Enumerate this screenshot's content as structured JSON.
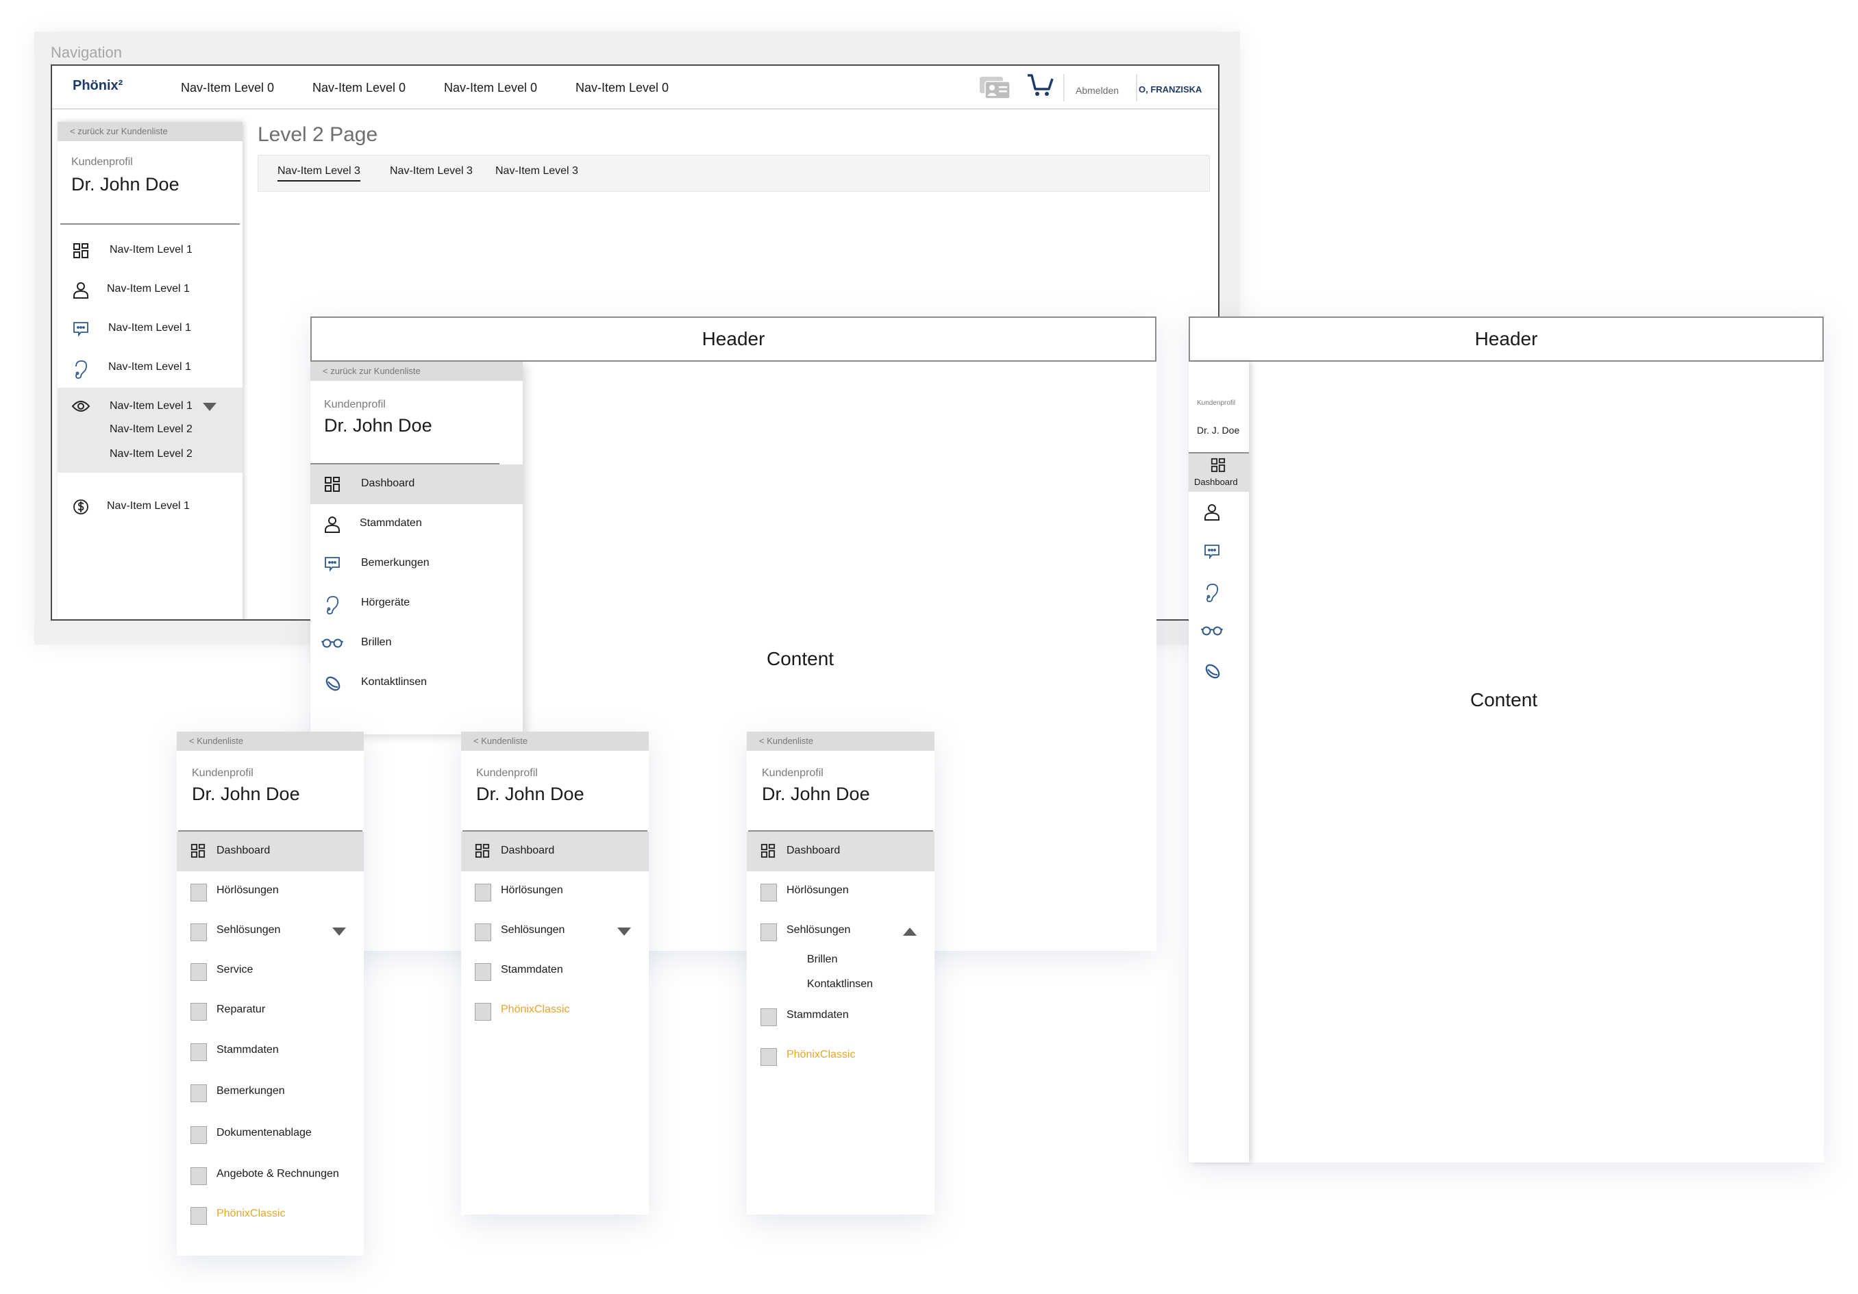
{
  "navigation_frame": {
    "title": "Navigation",
    "topbar": {
      "logo": "Phönix²",
      "items": [
        "Nav-Item Level 0",
        "Nav-Item Level 0",
        "Nav-Item Level 0",
        "Nav-Item Level 0"
      ],
      "logout": "Abmelden",
      "user": "O, FRANZISKA",
      "icons": [
        "id-card-icon",
        "cart-icon"
      ]
    },
    "sidebar": {
      "back": "< zurück zur Kundenliste",
      "profile_label": "Kundenprofil",
      "profile_name": "Dr. John Doe",
      "items": [
        {
          "label": "Nav-Item Level 1",
          "icon": "dashboard-icon"
        },
        {
          "label": "Nav-Item Level 1",
          "icon": "person-icon"
        },
        {
          "label": "Nav-Item Level 1",
          "icon": "comment-icon"
        },
        {
          "label": "Nav-Item Level 1",
          "icon": "ear-icon"
        },
        {
          "label": "Nav-Item Level 1",
          "icon": "eye-icon",
          "expanded": true,
          "children": [
            "Nav-Item Level 2",
            "Nav-Item Level 2"
          ]
        },
        {
          "label": "Nav-Item Level 1",
          "icon": "dollar-icon"
        }
      ]
    },
    "page_title": "Level 2 Page",
    "level3_tabs": [
      {
        "label": "Nav-Item Level 3",
        "active": true
      },
      {
        "label": "Nav-Item Level 3",
        "active": false
      },
      {
        "label": "Nav-Item Level 3",
        "active": false
      }
    ]
  },
  "desktop_expanded": {
    "header": "Header",
    "content": "Content",
    "sidebar": {
      "back": "< zurück zur Kundenliste",
      "profile_label": "Kundenprofil",
      "profile_name": "Dr. John Doe",
      "items": [
        {
          "label": "Dashboard",
          "icon": "dashboard-icon",
          "active": true
        },
        {
          "label": "Stammdaten",
          "icon": "person-icon"
        },
        {
          "label": "Bemerkungen",
          "icon": "comment-icon"
        },
        {
          "label": "Hörgeräte",
          "icon": "ear-icon"
        },
        {
          "label": "Brillen",
          "icon": "glasses-icon"
        },
        {
          "label": "Kontaktlinsen",
          "icon": "contact-lens-icon"
        }
      ]
    }
  },
  "desktop_collapsed": {
    "header": "Header",
    "content": "Content",
    "sidebar": {
      "profile_label": "Kundenprofil",
      "profile_name": "Dr. J. Doe",
      "active_label": "Dashboard",
      "icons": [
        "dashboard-icon",
        "person-icon",
        "comment-icon",
        "ear-icon",
        "glasses-icon",
        "contact-lens-icon"
      ]
    }
  },
  "mobile_panels": [
    {
      "back": "< Kundenliste",
      "profile_label": "Kundenprofil",
      "profile_name": "Dr. John Doe",
      "items": [
        {
          "label": "Dashboard",
          "active": true
        },
        {
          "label": "Hörlösungen"
        },
        {
          "label": "Sehlösungen",
          "caret": "down"
        },
        {
          "label": "Service"
        },
        {
          "label": "Reparatur"
        },
        {
          "label": "Stammdaten"
        },
        {
          "label": "Bemerkungen"
        },
        {
          "label": "Dokumentenablage"
        },
        {
          "label": "Angebote & Rechnungen"
        },
        {
          "label": "PhönixClassic",
          "brand": true
        }
      ]
    },
    {
      "back": "< Kundenliste",
      "profile_label": "Kundenprofil",
      "profile_name": "Dr. John Doe",
      "items": [
        {
          "label": "Dashboard",
          "active": true
        },
        {
          "label": "Hörlösungen"
        },
        {
          "label": "Sehlösungen",
          "caret": "down"
        },
        {
          "label": "Stammdaten"
        },
        {
          "label": "PhönixClassic",
          "brand": true
        }
      ]
    },
    {
      "back": "< Kundenliste",
      "profile_label": "Kundenprofil",
      "profile_name": "Dr. John Doe",
      "items": [
        {
          "label": "Dashboard",
          "active": true
        },
        {
          "label": "Hörlösungen"
        },
        {
          "label": "Sehlösungen",
          "caret": "up",
          "children": [
            "Brillen",
            "Kontaktlinsen"
          ]
        },
        {
          "label": "Stammdaten"
        },
        {
          "label": "PhönixClassic",
          "brand": true
        }
      ]
    }
  ],
  "colors": {
    "brand_blue": "#1e3a66",
    "icon_blue": "#2d5a8c",
    "accent_orange": "#e5a72c",
    "active_bg": "#e0e0e0"
  }
}
